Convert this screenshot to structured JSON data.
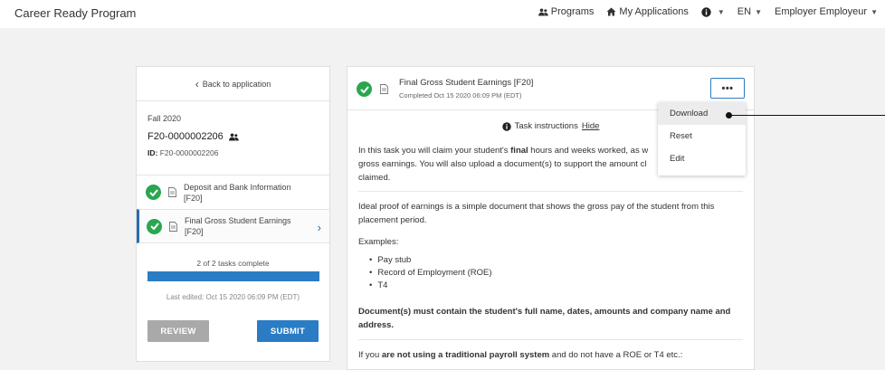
{
  "header": {
    "brand": "Career Ready Program",
    "nav": {
      "programs": "Programs",
      "my_applications": "My Applications",
      "language": "EN",
      "user": "Employer Employeur"
    }
  },
  "sidebar": {
    "back_label": "Back to application",
    "term": "Fall 2020",
    "application_number": "F20-0000002206",
    "id_label": "ID:",
    "id_value": "F20-0000002206",
    "tasks": [
      {
        "label": "Deposit and Bank Information [F20]",
        "completed": true
      },
      {
        "label": "Final Gross Student Earnings [F20]",
        "completed": true,
        "selected": true
      }
    ],
    "progress_text": "2 of 2 tasks complete",
    "progress_fraction": 1.0,
    "last_edited": "Last edited: Oct 15 2020 06:09 PM (EDT)",
    "review_label": "REVIEW",
    "submit_label": "SUBMIT"
  },
  "task": {
    "title": "Final Gross Student Earnings [F20]",
    "completed_text": "Completed Oct 15 2020 06:09 PM (EDT)",
    "more_label": "•••",
    "instructions_label": "Task instructions",
    "hide_label": "Hide",
    "p1_a": "In this task you will claim your student's ",
    "p1_bold": "final",
    "p1_b": " hours and weeks worked, as w",
    "p1_c": "gross earnings. You will also upload a document(s) to support the amount cl",
    "p1_d": "claimed.",
    "p2": "Ideal proof of earnings is a simple document that shows the gross pay of the student from this placement period.",
    "examples_label": "Examples:",
    "examples": [
      "Pay stub",
      "Record of Employment (ROE)",
      "T4"
    ],
    "p4": "Document(s) must contain the student's full name, dates, amounts and company name and address.",
    "p5_a": "If you ",
    "p5_bold": "are not using a traditional payroll system",
    "p5_b": " and do not have a ROE or T4 etc.:"
  },
  "menu": {
    "items": [
      "Download",
      "Reset",
      "Edit"
    ],
    "active": "Download"
  },
  "colors": {
    "accent": "#2a7cc4",
    "success": "#2aa650",
    "muted_button": "#a9a9a9"
  }
}
